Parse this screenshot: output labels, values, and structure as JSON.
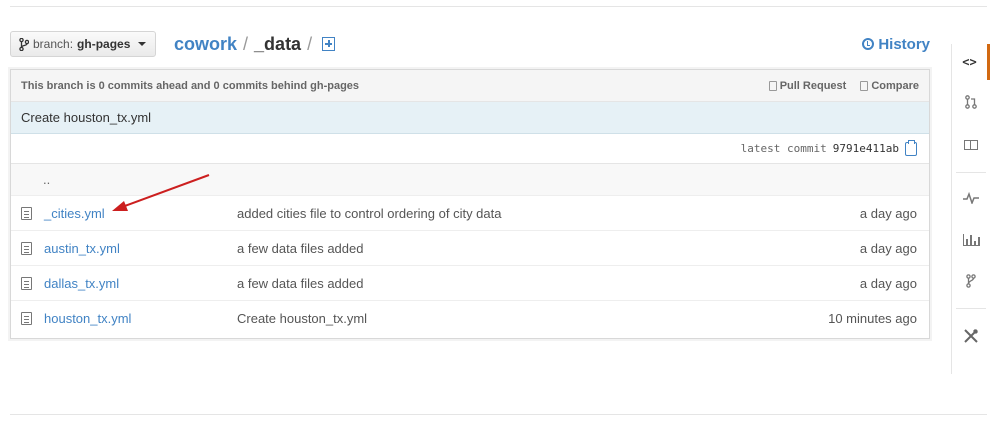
{
  "branch": {
    "label": "branch:",
    "name": "gh-pages"
  },
  "breadcrumb": {
    "repo": "cowork",
    "sep1": "/",
    "dir": "_data",
    "sep2": "/"
  },
  "history_label": "History",
  "compare_bar": {
    "status": "This branch is 0 commits ahead and 0 commits behind gh-pages",
    "pull_request_label": "Pull Request",
    "compare_label": "Compare"
  },
  "latest_commit": {
    "message": "Create houston_tx.yml",
    "label": "latest commit",
    "sha": "9791e411ab"
  },
  "parent_dir": "..",
  "files": [
    {
      "name": "_cities.yml",
      "message": "added cities file to control ordering of city data",
      "age": "a day ago"
    },
    {
      "name": "austin_tx.yml",
      "message": "a few data files added",
      "age": "a day ago"
    },
    {
      "name": "dallas_tx.yml",
      "message": "a few data files added",
      "age": "a day ago"
    },
    {
      "name": "houston_tx.yml",
      "message": "Create houston_tx.yml",
      "age": "10 minutes ago"
    }
  ],
  "sidebar": {
    "code_glyph": "<>",
    "items": [
      "code-icon",
      "pull-request-icon",
      "wiki-icon",
      "pulse-icon",
      "graphs-icon",
      "network-icon",
      "settings-icon"
    ]
  },
  "colors": {
    "link": "#4183c4",
    "active_tab": "#d26911",
    "commit_bg": "#e6f1f6",
    "annotation_arrow": "#cc1f1f"
  }
}
